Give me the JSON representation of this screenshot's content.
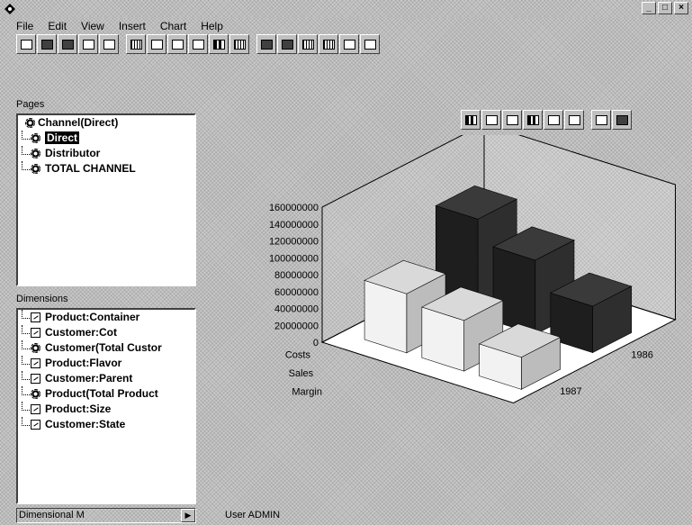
{
  "menu": [
    "File",
    "Edit",
    "View",
    "Insert",
    "Chart",
    "Help"
  ],
  "pages_label": "Pages",
  "pages_tree": [
    {
      "label": "Channel(Direct)",
      "icon": "gear-icon",
      "root": true
    },
    {
      "label": "Direct",
      "icon": "gear-icon",
      "selected": true
    },
    {
      "label": "Distributor",
      "icon": "gear-icon"
    },
    {
      "label": "TOTAL CHANNEL",
      "icon": "gear-icon"
    }
  ],
  "dimensions_label": "Dimensions",
  "dimensions": [
    {
      "label": "Product:Container",
      "icon": "dimension-icon"
    },
    {
      "label": "Customer:Cot",
      "icon": "dimension-icon"
    },
    {
      "label": "Customer(Total Custor",
      "icon": "gear-icon"
    },
    {
      "label": "Product:Flavor",
      "icon": "dimension-icon"
    },
    {
      "label": "Customer:Parent",
      "icon": "dimension-icon"
    },
    {
      "label": "Product(Total Product",
      "icon": "gear-icon"
    },
    {
      "label": "Product:Size",
      "icon": "dimension-icon"
    },
    {
      "label": "Customer:State",
      "icon": "dimension-icon"
    }
  ],
  "status": {
    "left": "Dimensional M",
    "user": "User  ADMIN"
  },
  "chart_data": {
    "type": "bar",
    "projection": "3d",
    "categories": [
      "Costs",
      "Sales",
      "Margin"
    ],
    "series": [
      {
        "name": "1987",
        "values": [
          70000000,
          60000000,
          38000000
        ]
      },
      {
        "name": "1986",
        "values": [
          115000000,
          88000000,
          55000000
        ]
      }
    ],
    "y_ticks": [
      "160000000",
      "140000000",
      "120000000",
      "100000000",
      "80000000",
      "60000000",
      "40000000",
      "20000000",
      "0"
    ],
    "ylim": [
      0,
      160000000
    ],
    "grid": false
  },
  "colors": {
    "chrome": "#c0c0c0",
    "bar_dark": "#2a2a2a",
    "bar_light": "#e8e8e8"
  }
}
